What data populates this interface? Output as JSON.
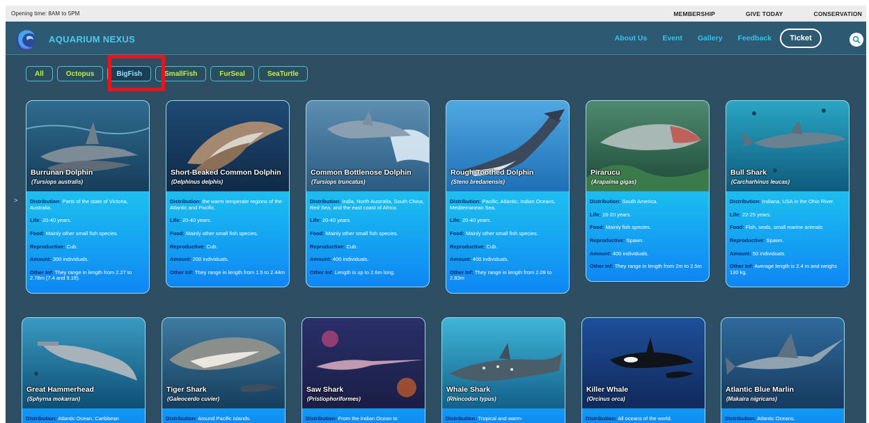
{
  "topbar": {
    "opening": "Opening time: 8AM to 5PM",
    "links": [
      "MEMBERSHIP",
      "GIVE TODAY",
      "CONSERVATION"
    ]
  },
  "header": {
    "brand": "AQUARIUM NEXUS",
    "nav": [
      "About Us",
      "Event",
      "Gallery",
      "Feedback"
    ],
    "ticket": "Ticket"
  },
  "filters": [
    "All",
    "Octopus",
    "BigFish",
    "SmallFish",
    "FurSeal",
    "SeaTurtle"
  ],
  "active_filter": "BigFish",
  "side_arrow": ">",
  "labels": {
    "distribution": "Distribution:",
    "life": "Life:",
    "food": "Food:",
    "reproductive": "Reproductive:",
    "amount": "Amount:",
    "other": "Other Inf:"
  },
  "cards": [
    {
      "name": "Burrunan Dolphin",
      "sci": "(Tursiops australis)",
      "distribution": "Parts of the state of Victoria, Australia.",
      "life": "20-40 years.",
      "food": "Mainly other small fish species.",
      "reproductive": "Cub.",
      "amount": "300 individuals.",
      "other": "They range in length from 2.27 to 2.78m (7.4 and 9.1ft)."
    },
    {
      "name": "Short-Beaked Common Dolphin",
      "sci": "(Delphinus delphis)",
      "distribution": "the warm temperate regions of the Atlantic and Pacific.",
      "life": "20-40 years.",
      "food": "Mainly other small fish species.",
      "reproductive": "Cub.",
      "amount": "200 individuals.",
      "other": "They range in length from 1.5 to 2.44m"
    },
    {
      "name": "Common Bottlenose Dolphin",
      "sci": "(Tursiops truncatus)",
      "distribution": "India, North Australia, South China, Red Sea, and the east coast of Africa.",
      "life": "20-40 years",
      "food": "Mainly other small fish species.",
      "reproductive": "Cub.",
      "amount": "400 individuals.",
      "other": "Length is up to 2.6m long."
    },
    {
      "name": "Rough-Toothed Dolphin",
      "sci": "(Steno bredanensis)",
      "distribution": "Pacific, Atlantic, Indian Oceans, Mediterranean Sea.",
      "life": "20-40 years.",
      "food": "Mainly other small fish species.",
      "reproductive": "Cub.",
      "amount": "400 individuals.",
      "other": "They range in length from 2.09 to 2.83m"
    },
    {
      "name": "Pirarucu",
      "sci": "(Arapaima gigas)",
      "distribution": "South America.",
      "life": "16-20 years.",
      "food": "Mainly fish species.",
      "reproductive": "Spawn.",
      "amount": "400 individuals.",
      "other": "They range in length from 2m to 2.5m"
    },
    {
      "name": "Bull Shark",
      "sci": "(Carcharhinus leucas)",
      "distribution": "Indiana, USA in the Ohio River.",
      "life": "22-25 years.",
      "food": "Fish, seals, small marine animals",
      "reproductive": "Spawn.",
      "amount": "50 individuals.",
      "other": "Average length is 2.4 m and weighs 130 kg."
    },
    {
      "name": "Great Hammerhead",
      "sci": "(Sphyrna mokarran)",
      "distribution": "Atlantic Ocean, Caribbean"
    },
    {
      "name": "Tiger Shark",
      "sci": "(Galeocerdo cuvier)",
      "distribution": "Around Pacific islands."
    },
    {
      "name": "Saw Shark",
      "sci": "(Pristiophoriformes)",
      "distribution": "From the Indian Ocean to"
    },
    {
      "name": "Whale Shark",
      "sci": "(Rhincodon typus)",
      "distribution": "Tropical and warm-"
    },
    {
      "name": "Killer Whale",
      "sci": "(Orcinus orca)",
      "distribution": "All oceans of the world."
    },
    {
      "name": "Atlantic Blue Marlin",
      "sci": "(Makaira nigricans)",
      "distribution": "Atlantic Oceans."
    }
  ]
}
